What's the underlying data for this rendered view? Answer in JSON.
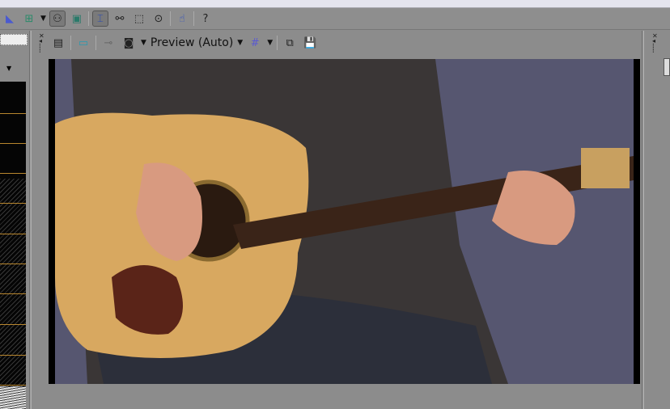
{
  "preview_toolbar": {
    "quality_label": "Preview (Auto)"
  },
  "icons": [
    "normal-edit-tool",
    "insert-track-icon",
    "auto-ripple-icon",
    "lock-envelopes-icon",
    "normal-edit-icon",
    "envelope-edit-icon",
    "selection-edit-icon",
    "zoom-edit-icon",
    "fx-icon",
    "whats-this-help-icon"
  ],
  "colors": {
    "panel": "#8c8c8c",
    "scope_grid": "#b8862e"
  }
}
